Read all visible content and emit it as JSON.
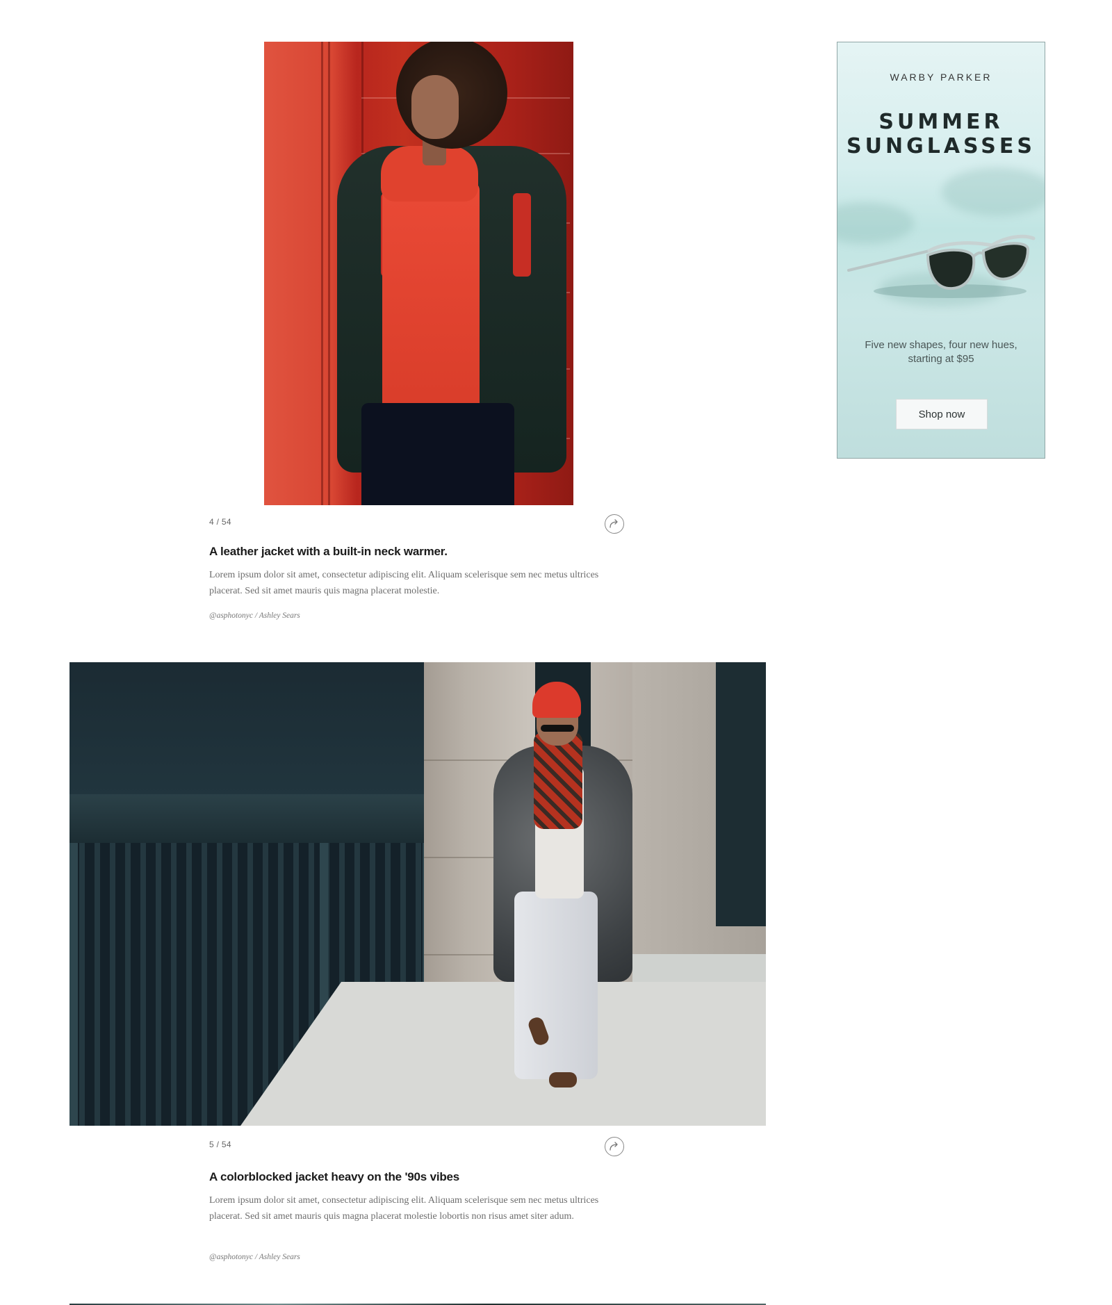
{
  "slides": [
    {
      "counter": "4 / 54",
      "headline": "A leather jacket with a built-in neck warmer.",
      "body": "Lorem ipsum dolor sit amet, consectetur adipiscing elit. Aliquam scelerisque sem nec metus ultrices placerat. Sed sit amet mauris quis magna placerat molestie.",
      "credit": "@asphotonyc / Ashley Sears"
    },
    {
      "counter": "5 / 54",
      "headline": "A colorblocked jacket heavy on the '90s vibes",
      "body": "Lorem ipsum dolor sit amet, consectetur adipiscing elit. Aliquam scelerisque sem nec metus ultrices placerat. Sed sit amet mauris quis magna placerat molestie lobortis non risus amet siter adum.",
      "credit": "@asphotonyc / Ashley Sears"
    }
  ],
  "ad": {
    "brand": "WARBY PARKER",
    "title_line1": "SUMMER",
    "title_line2": "SUNGLASSES",
    "copy": "Five new shapes, four new hues, starting at $95",
    "cta": "Shop now",
    "colors": {
      "background": "#d3ecea",
      "lens": "#1e2a24"
    }
  },
  "icons": {
    "share": "share-arrow-icon"
  }
}
